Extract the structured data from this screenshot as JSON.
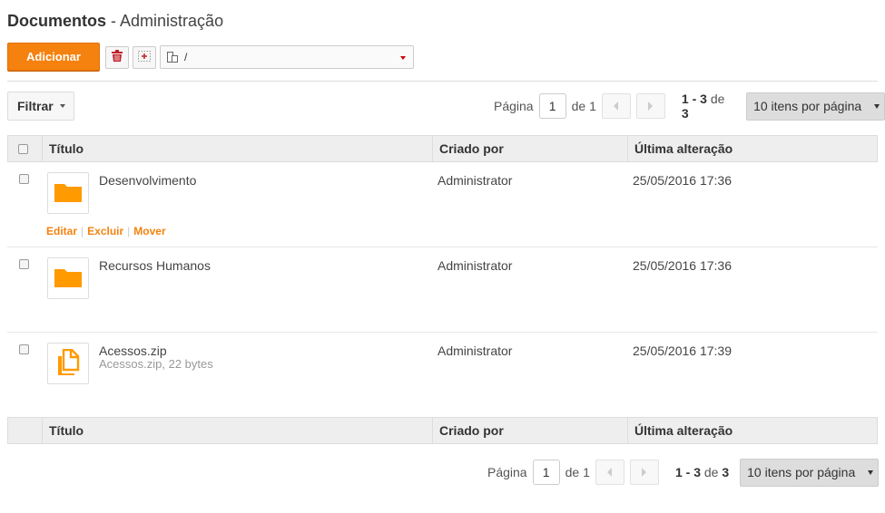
{
  "header": {
    "title": "Documentos",
    "subtitle": "- Administração"
  },
  "toolbar": {
    "add_label": "Adicionar",
    "path_value": "/",
    "icons": [
      "trash-icon",
      "new-folder-icon",
      "folder-path-icon"
    ]
  },
  "filter": {
    "label": "Filtrar"
  },
  "pager": {
    "page_label": "Página",
    "page_value": "1",
    "of_label": "de",
    "total_pages": "1",
    "range": "1 - 3",
    "range_of": "de",
    "total": "3",
    "per_page": "10 itens por página"
  },
  "table": {
    "columns": [
      "Título",
      "Criado por",
      "Última alteração"
    ],
    "rows": [
      {
        "title": "Desenvolvimento",
        "subtitle": "",
        "created_by": "Administrator",
        "modified": "25/05/2016 17:36",
        "icon": "folder-icon"
      },
      {
        "title": "Recursos Humanos",
        "subtitle": "",
        "created_by": "Administrator",
        "modified": "25/05/2016 17:36",
        "icon": "folder-icon"
      },
      {
        "title": "Acessos.zip",
        "subtitle": "Acessos.zip, 22 bytes",
        "created_by": "Administrator",
        "modified": "25/05/2016 17:39",
        "icon": "file-icon"
      }
    ],
    "row_actions": {
      "edit": "Editar",
      "delete": "Excluir",
      "move": "Mover"
    }
  },
  "colors": {
    "accent": "#f5820f",
    "folder": "#ff9a00"
  }
}
